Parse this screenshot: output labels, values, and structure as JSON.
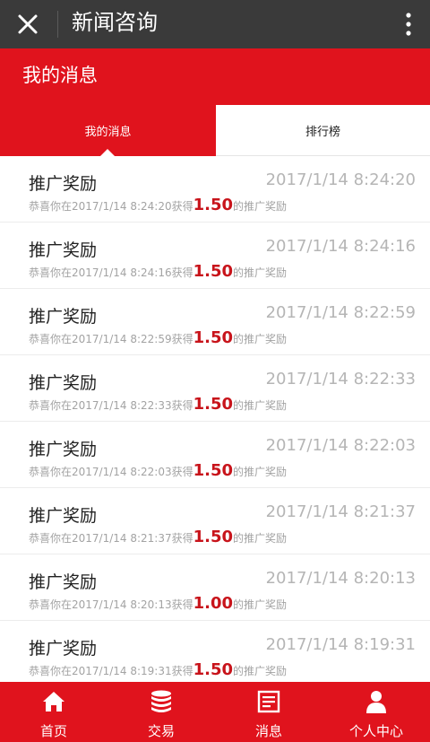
{
  "topbar": {
    "title": "新闻咨询"
  },
  "subheader": {
    "title": "我的消息"
  },
  "tabs": [
    {
      "label": "我的消息",
      "active": true
    },
    {
      "label": "排行榜",
      "active": false
    }
  ],
  "messages": [
    {
      "title": "推广奖励",
      "time": "2017/1/14 8:24:20",
      "prefix": "恭喜你在2017/1/14 8:24:20获得",
      "amount": "1.50",
      "suffix": "的推广奖励"
    },
    {
      "title": "推广奖励",
      "time": "2017/1/14 8:24:16",
      "prefix": "恭喜你在2017/1/14 8:24:16获得",
      "amount": "1.50",
      "suffix": "的推广奖励"
    },
    {
      "title": "推广奖励",
      "time": "2017/1/14 8:22:59",
      "prefix": "恭喜你在2017/1/14 8:22:59获得",
      "amount": "1.50",
      "suffix": "的推广奖励"
    },
    {
      "title": "推广奖励",
      "time": "2017/1/14 8:22:33",
      "prefix": "恭喜你在2017/1/14 8:22:33获得",
      "amount": "1.50",
      "suffix": "的推广奖励"
    },
    {
      "title": "推广奖励",
      "time": "2017/1/14 8:22:03",
      "prefix": "恭喜你在2017/1/14 8:22:03获得",
      "amount": "1.50",
      "suffix": "的推广奖励"
    },
    {
      "title": "推广奖励",
      "time": "2017/1/14 8:21:37",
      "prefix": "恭喜你在2017/1/14 8:21:37获得",
      "amount": "1.50",
      "suffix": "的推广奖励"
    },
    {
      "title": "推广奖励",
      "time": "2017/1/14 8:20:13",
      "prefix": "恭喜你在2017/1/14 8:20:13获得",
      "amount": "1.00",
      "suffix": "的推广奖励"
    },
    {
      "title": "推广奖励",
      "time": "2017/1/14 8:19:31",
      "prefix": "恭喜你在2017/1/14 8:19:31获得",
      "amount": "1.50",
      "suffix": "的推广奖励"
    }
  ],
  "bottom_nav": [
    {
      "label": "首页",
      "icon": "home-icon"
    },
    {
      "label": "交易",
      "icon": "database-icon"
    },
    {
      "label": "消息",
      "icon": "message-board-icon"
    },
    {
      "label": "个人中心",
      "icon": "user-icon"
    }
  ],
  "colors": {
    "brand_red": "#e0131d",
    "amount_red": "#c8141b",
    "topbar": "#3a3a3a"
  }
}
